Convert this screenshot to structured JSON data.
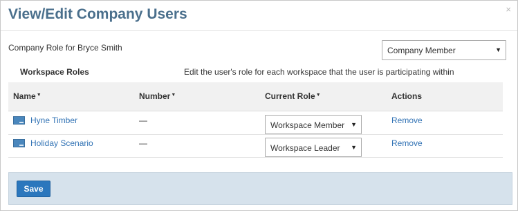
{
  "dialog": {
    "title": "View/Edit Company Users",
    "close_label": "×"
  },
  "company": {
    "label": "Company Role for Bryce Smith",
    "selected_role": "Company Member",
    "arrow": "▼"
  },
  "workspace_roles": {
    "heading": "Workspace Roles",
    "description": "Edit the user's role for each workspace that the user is participating within"
  },
  "table": {
    "columns": {
      "name": "Name",
      "number": "Number",
      "current_role": "Current Role",
      "actions": "Actions"
    },
    "sort_glyph": "▼",
    "rows": [
      {
        "name": "Hyne Timber",
        "number": "—",
        "role": "Workspace Member",
        "action": "Remove"
      },
      {
        "name": "Holiday Scenario",
        "number": "—",
        "role": "Workspace Leader",
        "action": "Remove"
      }
    ]
  },
  "footer": {
    "save_label": "Save"
  },
  "colors": {
    "title": "#4a6f8c",
    "link": "#3273b5",
    "save_button": "#2b77bd",
    "footer_bg": "#d6e2ec",
    "table_header_bg": "#f1f1f1"
  }
}
